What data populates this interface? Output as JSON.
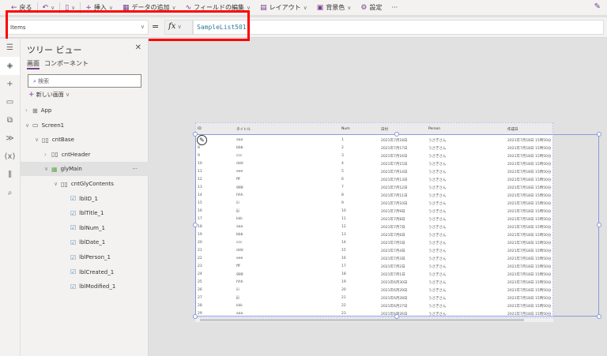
{
  "toolbar": {
    "back": "戻る",
    "insert": "挿入",
    "add_data": "データの追加",
    "edit_fields": "フィールドの編集",
    "layout": "レイアウト",
    "background": "背景色",
    "settings": "設定",
    "more": "···"
  },
  "formula": {
    "property": "Items",
    "equals": "=",
    "fx": "fx",
    "value": "SampleList501"
  },
  "tree": {
    "title": "ツリー ビュー",
    "tabs": [
      "画面",
      "コンポーネント"
    ],
    "search_placeholder": "検索",
    "new_screen": "新しい画面",
    "nodes": [
      {
        "label": "App",
        "icon": "app-icon"
      },
      {
        "label": "Screen1",
        "icon": "screen-icon"
      },
      {
        "label": "cntBase",
        "icon": "container-icon"
      },
      {
        "label": "cntHeader",
        "icon": "container-icon"
      },
      {
        "label": "glyMain",
        "icon": "gallery-icon"
      },
      {
        "label": "cntGlyContents",
        "icon": "container-icon"
      },
      {
        "label": "lblID_1",
        "icon": "label-icon"
      },
      {
        "label": "lblTitle_1",
        "icon": "label-icon"
      },
      {
        "label": "lblNum_1",
        "icon": "label-icon"
      },
      {
        "label": "lblDate_1",
        "icon": "label-icon"
      },
      {
        "label": "lblPerson_1",
        "icon": "label-icon"
      },
      {
        "label": "lblCreated_1",
        "icon": "label-icon"
      },
      {
        "label": "lblModified_1",
        "icon": "label-icon"
      }
    ],
    "more": "···"
  },
  "table": {
    "headers": [
      "ID",
      "タイトル",
      "Num",
      "日付",
      "Person",
      "作成日"
    ],
    "rows": [
      [
        "7",
        "aaa",
        "1",
        "2021年7月18日",
        "うさぎさん",
        "2021年7月18日 15時50分"
      ],
      [
        "8",
        "bbb",
        "2",
        "2021年7月17日",
        "うさぎさん",
        "2021年7月18日 15時50分"
      ],
      [
        "9",
        "ccc",
        "3",
        "2021年7月16日",
        "うさぎさん",
        "2021年7月18日 15時50分"
      ],
      [
        "10",
        "ddd",
        "4",
        "2021年7月15日",
        "うさぎさん",
        "2021年7月18日 15時50分"
      ],
      [
        "11",
        "eee",
        "5",
        "2021年7月14日",
        "うさぎさん",
        "2021年7月18日 15時50分"
      ],
      [
        "12",
        "fff",
        "6",
        "2021年7月13日",
        "うさぎさん",
        "2021年7月18日 15時50分"
      ],
      [
        "13",
        "ggg",
        "7",
        "2021年7月12日",
        "うさぎさん",
        "2021年7月18日 15時50分"
      ],
      [
        "14",
        "hhh",
        "8",
        "2021年7月11日",
        "うさぎさん",
        "2021年7月18日 15時50分"
      ],
      [
        "15",
        "iii",
        "9",
        "2021年7月10日",
        "うさぎさん",
        "2021年7月18日 15時50分"
      ],
      [
        "16",
        "jjj",
        "10",
        "2021年7月9日",
        "うさぎさん",
        "2021年7月18日 15時50分"
      ],
      [
        "17",
        "kkk",
        "11",
        "2021年7月8日",
        "うさぎさん",
        "2021年7月18日 15時50分"
      ],
      [
        "18",
        "aaa",
        "12",
        "2021年7月7日",
        "うさぎさん",
        "2021年7月18日 15時50分"
      ],
      [
        "19",
        "bbb",
        "13",
        "2021年7月6日",
        "うさぎさん",
        "2021年7月18日 15時50分"
      ],
      [
        "20",
        "ccc",
        "14",
        "2021年7月5日",
        "うさぎさん",
        "2021年7月18日 15時50分"
      ],
      [
        "21",
        "ddd",
        "15",
        "2021年7月4日",
        "うさぎさん",
        "2021年7月18日 15時50分"
      ],
      [
        "22",
        "eee",
        "16",
        "2021年7月3日",
        "うさぎさん",
        "2021年7月18日 15時50分"
      ],
      [
        "23",
        "fff",
        "17",
        "2021年7月2日",
        "うさぎさん",
        "2021年7月18日 15時50分"
      ],
      [
        "24",
        "ggg",
        "18",
        "2021年7月1日",
        "うさぎさん",
        "2021年7月18日 15時50分"
      ],
      [
        "25",
        "hhh",
        "19",
        "2021年6月30日",
        "うさぎさん",
        "2021年7月18日 15時50分"
      ],
      [
        "26",
        "iii",
        "20",
        "2021年6月29日",
        "うさぎさん",
        "2021年7月18日 15時50分"
      ],
      [
        "27",
        "jjj",
        "21",
        "2021年6月28日",
        "うさぎさん",
        "2021年7月18日 15時50分"
      ],
      [
        "28",
        "kkk",
        "22",
        "2021年6月27日",
        "うさぎさん",
        "2021年7月18日 15時50分"
      ],
      [
        "29",
        "aaa",
        "23",
        "2021年6月26日",
        "うさぎさん",
        "2021年7月18日 15時50分"
      ]
    ]
  },
  "colors": {
    "accent": "#7a3e8e",
    "highlight": "#ff0000",
    "selection": "#8a9ad8"
  }
}
